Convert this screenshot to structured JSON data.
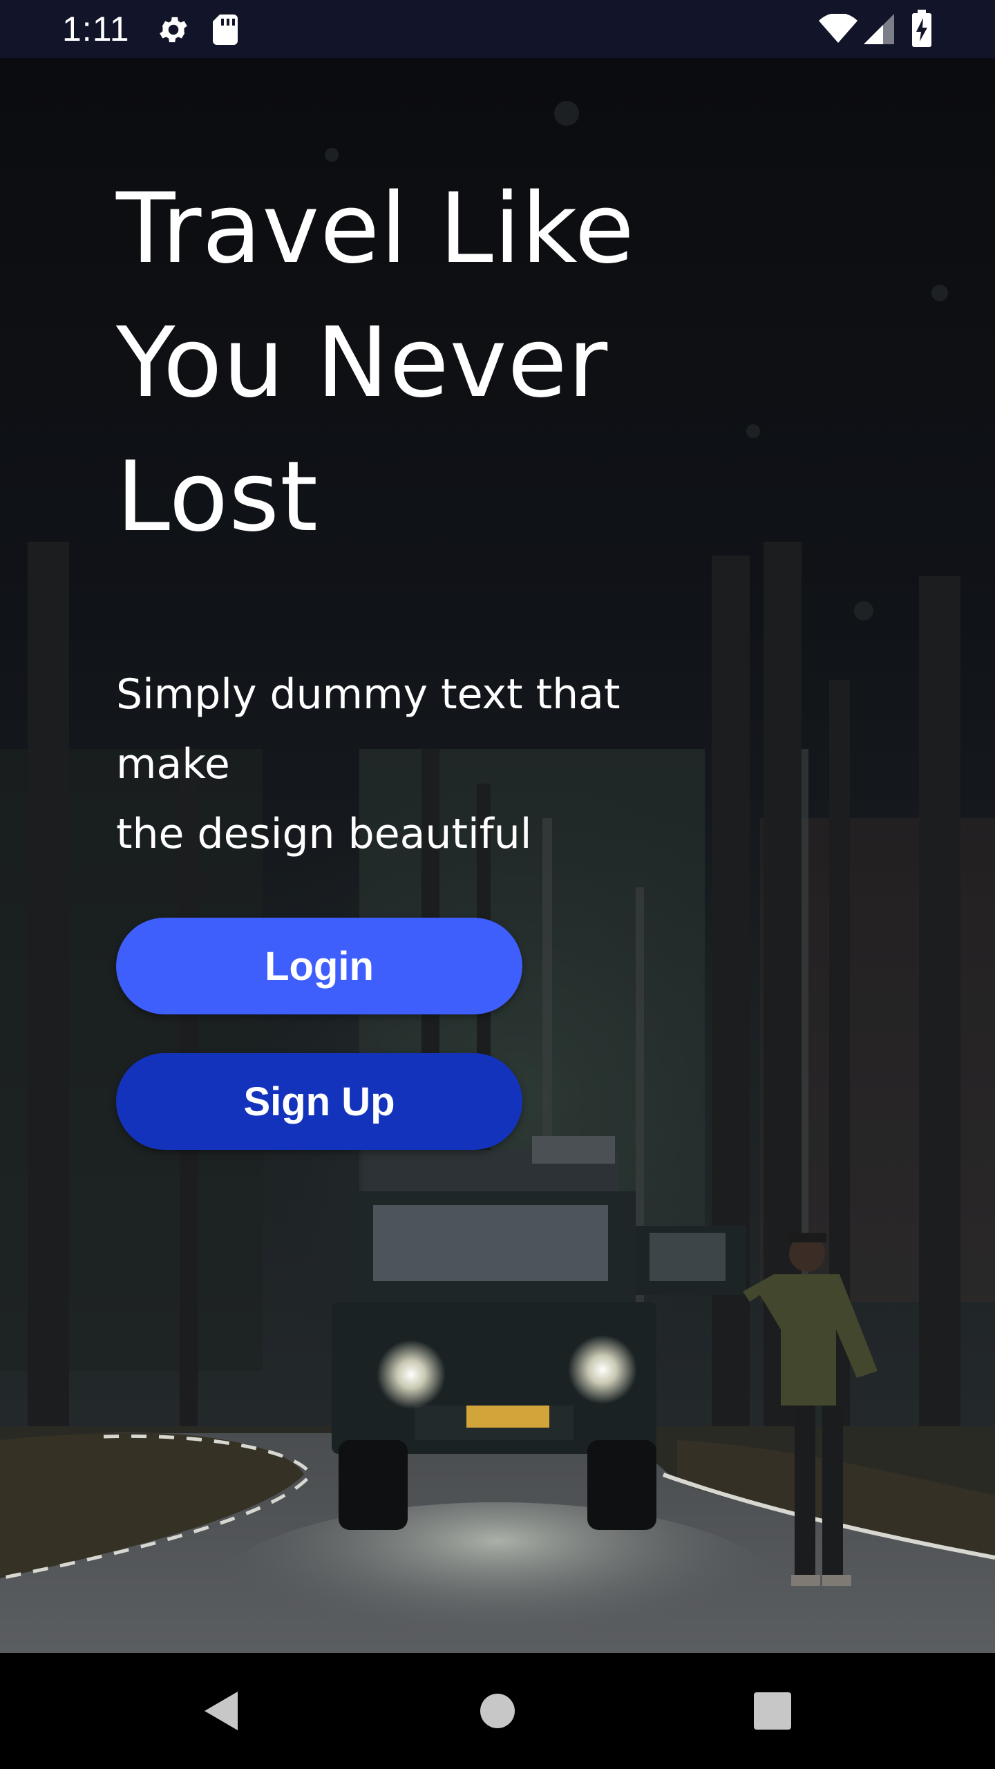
{
  "status_bar": {
    "time": "1:11",
    "icons": [
      "settings-icon",
      "sd-card-icon",
      "wifi-icon",
      "signal-icon",
      "battery-charging-icon"
    ]
  },
  "hero": {
    "headline_lines": [
      "Travel Like",
      "You Never",
      "Lost"
    ],
    "subtitle_lines": [
      "Simply dummy text that make",
      "the design beautiful"
    ]
  },
  "buttons": {
    "login_label": "Login",
    "signup_label": "Sign Up"
  },
  "nav_bar": {
    "icons": [
      "back-icon",
      "home-icon",
      "recents-icon"
    ]
  },
  "colors": {
    "login_button": "#3f5ffd",
    "signup_button": "#1433bd",
    "status_bar": "#12152a",
    "nav_bar": "#000000"
  }
}
